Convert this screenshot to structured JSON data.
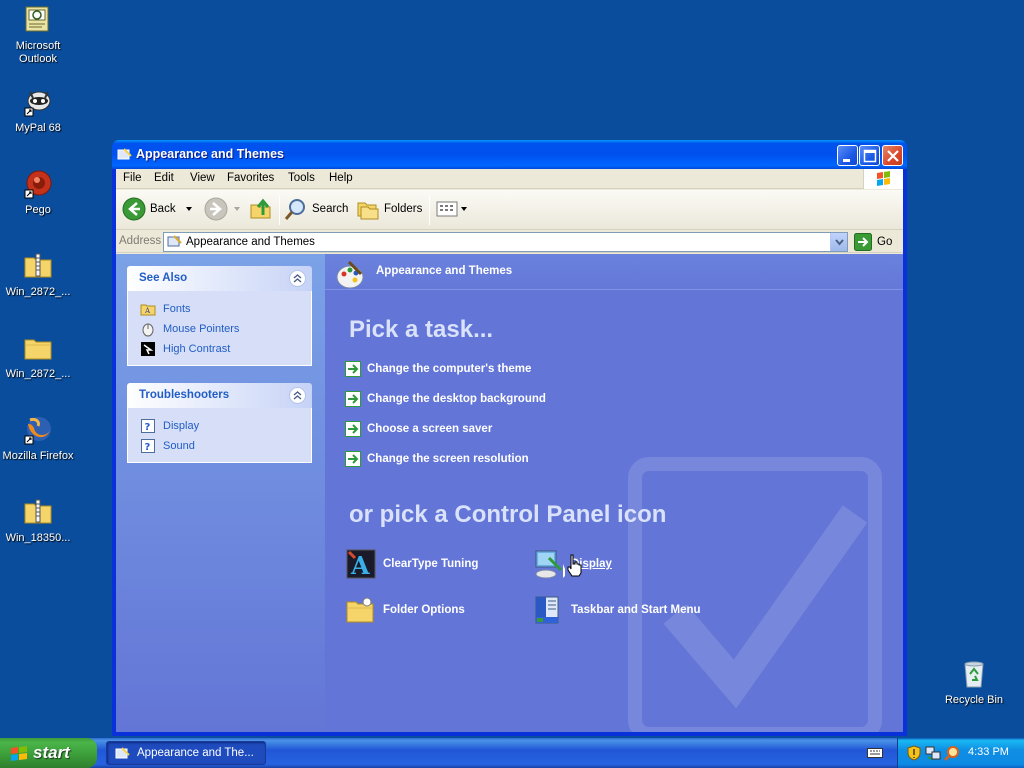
{
  "desktop": {
    "icons": [
      {
        "label": "Microsoft Outlook",
        "icon": "outlook-icon"
      },
      {
        "label": "MyPal 68",
        "icon": "mypal-icon"
      },
      {
        "label": "Pego",
        "icon": "pego-icon"
      },
      {
        "label": "Win_2872_...",
        "icon": "zip-folder-icon"
      },
      {
        "label": "Win_2872_...",
        "icon": "folder-icon"
      },
      {
        "label": "Mozilla Firefox",
        "icon": "firefox-icon"
      },
      {
        "label": "Win_18350...",
        "icon": "zip-folder-icon"
      },
      {
        "label": "Recycle Bin",
        "icon": "recycle-bin-icon"
      }
    ]
  },
  "window": {
    "title": "Appearance and Themes",
    "menu": [
      "File",
      "Edit",
      "View",
      "Favorites",
      "Tools",
      "Help"
    ],
    "toolbar": {
      "back": "Back",
      "search": "Search",
      "folders": "Folders"
    },
    "address": {
      "label": "Address",
      "value": "Appearance and Themes",
      "go": "Go"
    }
  },
  "taskpane": {
    "see_also": {
      "title": "See Also",
      "links": [
        "Fonts",
        "Mouse Pointers",
        "High Contrast"
      ]
    },
    "troubleshooters": {
      "title": "Troubleshooters",
      "links": [
        "Display",
        "Sound"
      ]
    }
  },
  "content": {
    "category_title": "Appearance and Themes",
    "pick_task_title": "Pick a task...",
    "tasks": [
      "Change the computer's theme",
      "Change the desktop background",
      "Choose a screen saver",
      "Change the screen resolution"
    ],
    "pick_icon_title": "or pick a Control Panel icon",
    "icons": [
      "ClearType Tuning",
      "Display",
      "Folder Options",
      "Taskbar and Start Menu"
    ]
  },
  "taskbar": {
    "start_label": "start",
    "task_button": "Appearance and The...",
    "clock": "4:33 PM"
  },
  "colors": {
    "desktop": "#0a4d9c",
    "title_bar": "#0054e3",
    "content_bg": "#6375d6",
    "taskpane_link": "#215dc6"
  }
}
